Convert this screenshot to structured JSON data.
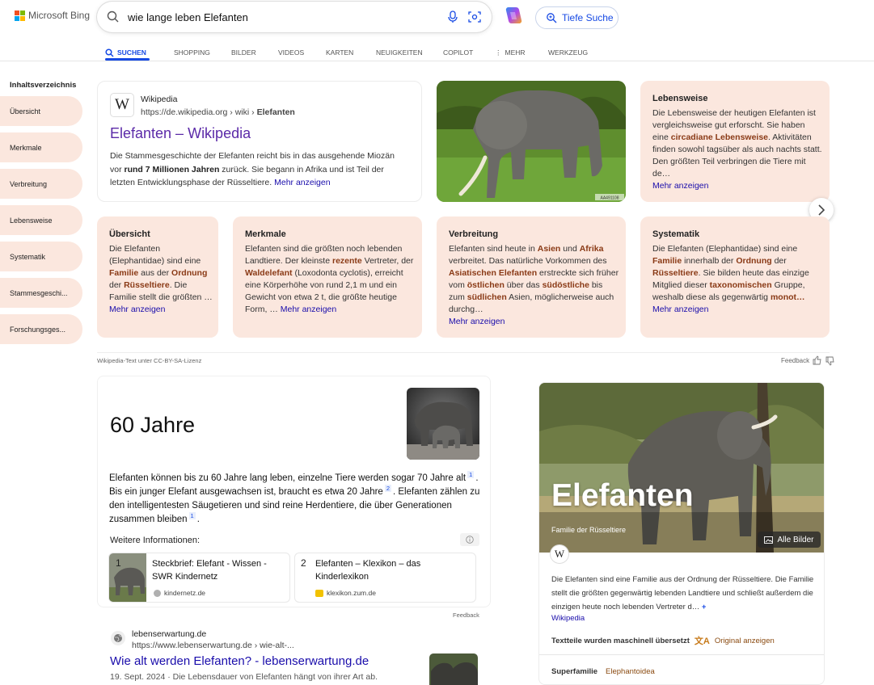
{
  "header": {
    "logo_text": "Microsoft Bing",
    "search_query": "wie lange leben Elefanten",
    "deep_search_label": "Tiefe Suche",
    "tabs": [
      {
        "label": "SUCHEN",
        "active": true
      },
      {
        "label": "SHOPPING"
      },
      {
        "label": "BILDER"
      },
      {
        "label": "VIDEOS"
      },
      {
        "label": "KARTEN"
      },
      {
        "label": "NEUIGKEITEN"
      },
      {
        "label": "COPILOT"
      },
      {
        "label": "MEHR"
      },
      {
        "label": "WERKZEUG"
      }
    ]
  },
  "toc": {
    "title": "Inhaltsverzeichnis",
    "items": [
      "Übersicht",
      "Merkmale",
      "Verbreitung",
      "Lebensweise",
      "Systematik",
      "Stammesgeschi...",
      "Forschungsges..."
    ]
  },
  "wiki_card": {
    "site": "Wikipedia",
    "url_prefix": "https://de.wikipedia.org › wiki › ",
    "url_bold": "Elefanten",
    "title": "Elefanten – Wikipedia",
    "snippet_1": "Die Stammesgeschichte der Elefanten reicht bis in das ausgehende Miozän vor ",
    "snippet_bold": "rund 7 Millionen Jahren",
    "snippet_2": " zurück. Sie begann in Afrika und ist Teil der letzten Entwicklungsphase der Rüsseltiere. ",
    "more": "Mehr anzeigen",
    "image_credit": "AA491108"
  },
  "topic_cards": {
    "lebensweise": {
      "title": "Lebensweise",
      "more": "Mehr anzeigen",
      "t1": "Die Lebensweise der heutigen Elefanten ist vergleichsweise gut erforscht. Sie haben eine ",
      "b1": "circadiane Lebensweise",
      "t2": ". Aktivitäten finden sowohl tagsüber als auch nachts statt. Den größten Teil verbringen die Tiere mit de…"
    },
    "uebersicht": {
      "title": "Übersicht",
      "more": "Mehr anzeigen",
      "t1": "Die Elefanten (Elephantidae) sind eine ",
      "b1": "Familie",
      "t2": " aus der ",
      "b2": "Ordnung",
      "t3": " der ",
      "b3": "Rüsseltiere",
      "t4": ". Die Familie stellt die größten …"
    },
    "merkmale": {
      "title": "Merkmale",
      "more": "Mehr anzeigen",
      "t1": "Elefanten sind die größten noch lebenden Landtiere. Der kleinste ",
      "b1": "rezente",
      "t2": " Vertreter, der ",
      "b2": "Waldelefant",
      "t3": " (Loxodonta cyclotis), erreicht eine Körperhöhe von rund 2,1 m und ein Gewicht von etwa 2 t, die größte heutige Form, … "
    },
    "verbreitung": {
      "title": "Verbreitung",
      "more": "Mehr anzeigen",
      "t1": "Elefanten sind heute in ",
      "b1": "Asien",
      "t2": " und ",
      "b2": "Afrika",
      "t3": " verbreitet. Das natürliche Vorkommen des ",
      "b3": "Asiatischen Elefanten",
      "t4": " erstreckte sich früher vom ",
      "b4": "östlichen",
      "t5": " über das ",
      "b5": "südöstliche",
      "t6": " bis zum ",
      "b6": "südlichen",
      "t7": " Asien, möglicherweise auch durchg…"
    },
    "systematik": {
      "title": "Systematik",
      "more": "Mehr anzeigen",
      "t1": "Die Elefanten (Elephantidae) sind eine ",
      "b1": "Familie",
      "t2": " innerhalb der ",
      "b2": "Ordnung",
      "t3": " der ",
      "b3": "Rüsseltiere",
      "t4": ". Sie bilden heute das einzige Mitglied dieser ",
      "b4": "taxonomischen",
      "t5": " Gruppe, weshalb diese als gegenwärtig ",
      "b5": "monot…",
      "t6": " "
    }
  },
  "license_note": "Wikipedia-Text unter CC-BY-SA-Lizenz",
  "feedback": "Feedback",
  "answer": {
    "value": "60 Jahre",
    "p1": "Elefanten können bis zu 60 Jahre lang leben, einzelne Tiere werden sogar 70 Jahre alt",
    "r1": "1",
    "p2": ". Bis ein junger Elefant ausgewachsen ist, braucht es etwa 20 Jahre",
    "r2": "2",
    "p3": ". Elefanten zählen zu den intelligentesten Säugetieren und sind reine Herdentiere, die über Generationen zusammen bleiben",
    "r3": "1",
    "p4": ".",
    "more_info": "Weitere Informationen:",
    "sources": [
      {
        "num": "1",
        "title": "Steckbrief: Elefant - Wissen - SWR Kindernetz",
        "domain": "kindernetz.de"
      },
      {
        "num": "2",
        "title": "Elefanten – Klexikon – das Kinderlexikon",
        "domain": "klexikon.zum.de"
      }
    ],
    "feedback": "Feedback"
  },
  "knowledge_panel": {
    "title": "Elefanten",
    "subtitle": "Familie der Rüsseltiere",
    "all_images": "Alle Bilder",
    "description": "Die Elefanten sind eine Familie aus der Ordnung der Rüsseltiere. Die Familie stellt die größten gegenwärtig lebenden Landtiere und schließt außerdem die einzigen heute noch lebenden Vertreter d…",
    "expand": "+",
    "source_link": "Wikipedia",
    "translated_note": "Textteile wurden maschinell übersetzt",
    "show_original": "Original anzeigen",
    "fact_label": "Superfamilie",
    "fact_value": "Elephantoidea"
  },
  "result2": {
    "site": "lebenserwartung.de",
    "url": "https://www.lebenserwartung.de › wie-alt-...",
    "title": "Wie alt werden Elefanten? - lebenserwartung.de",
    "date": "19. Sept. 2024",
    "snippet": " · Die Lebensdauer von Elefanten hängt von ihrer Art ab."
  },
  "colors": {
    "accent": "#174ae4",
    "link": "#1a0dab",
    "peach": "#fbe7de",
    "keyword": "#8a3a16"
  }
}
